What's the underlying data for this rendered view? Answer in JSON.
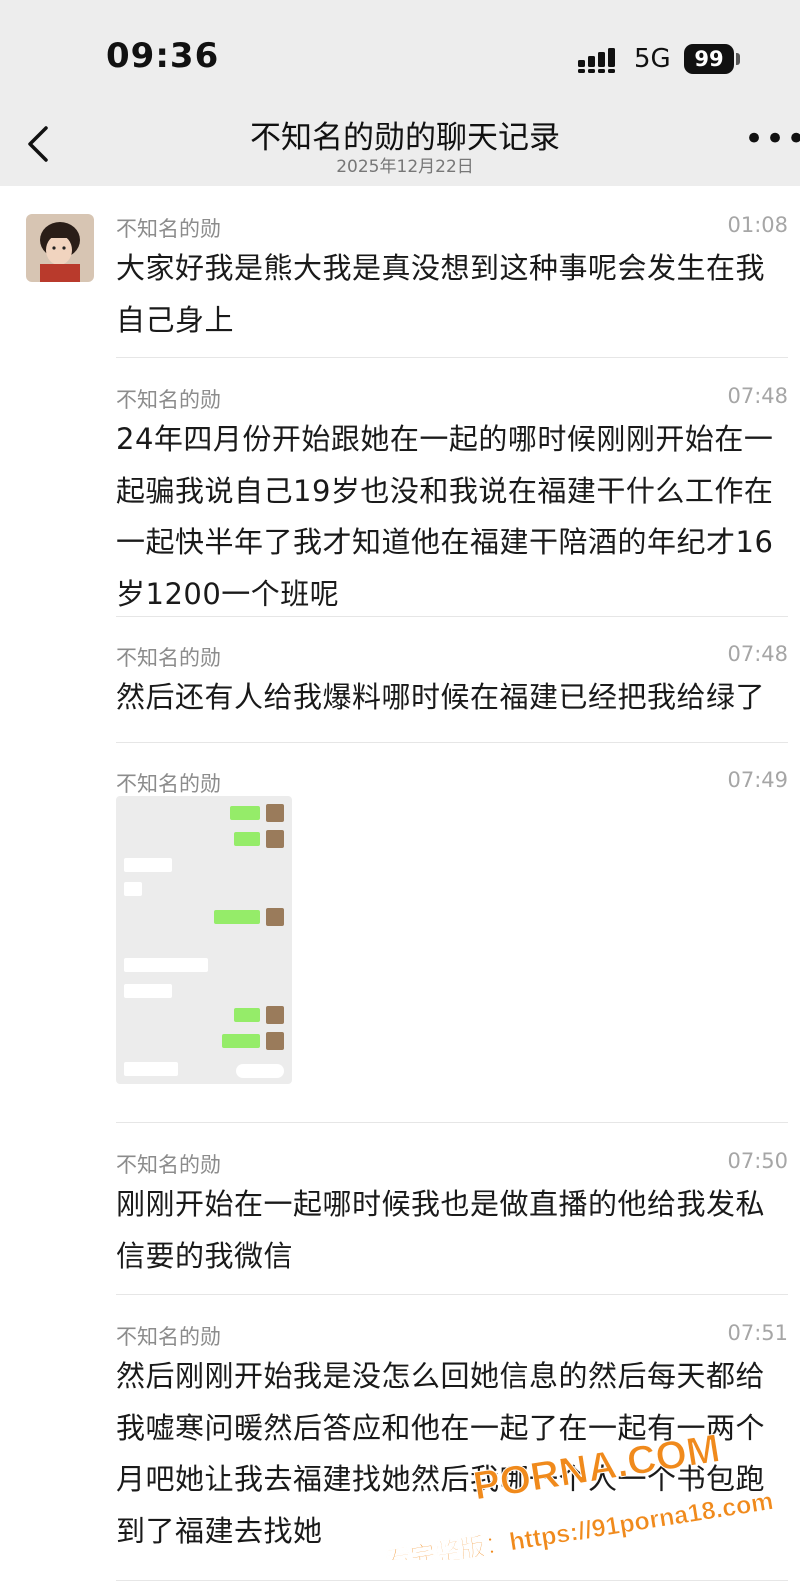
{
  "status_bar": {
    "time": "09:36",
    "network": "5G",
    "battery": "99"
  },
  "header": {
    "title": "不知名的勋的聊天记录",
    "date": "2025年12月22日"
  },
  "messages": [
    {
      "sender": "不知名的勋",
      "time": "01:08",
      "text": "大家好我是熊大我是真没想到这种事呢会发生在我自己身上"
    },
    {
      "sender": "不知名的勋",
      "time": "07:48",
      "text": "24年四月份开始跟她在一起的哪时候刚刚开始在一起骗我说自己19岁也没和我说在福建干什么工作在一起快半年了我才知道他在福建干陪酒的年纪才16岁1200一个班呢"
    },
    {
      "sender": "不知名的勋",
      "time": "07:48",
      "text": "然后还有人给我爆料哪时候在福建已经把我给绿了"
    },
    {
      "sender": "不知名的勋",
      "time": "07:49",
      "image": "chat-screenshot"
    },
    {
      "sender": "不知名的勋",
      "time": "07:50",
      "text": "刚刚开始在一起哪时候我也是做直播的他给我发私信要的我微信"
    },
    {
      "sender": "不知名的勋",
      "time": "07:51",
      "text": "然后刚刚开始我是没怎么回她信息的然后每天都给我嘘寒问暖然后答应和他在一起了在一起有一两个月吧她让我去福建找她然后我哪一个人一个书包跑到了福建去找她"
    }
  ],
  "watermark": {
    "brand": "PORNA.COM",
    "text": "看完整版：https://91porna18.com"
  },
  "colors": {
    "header_bg": "#ededed",
    "sender": "#8c8c8c",
    "time": "#a6a6a6",
    "bubble_green": "#95ec69",
    "watermark": "#f08a1c"
  }
}
